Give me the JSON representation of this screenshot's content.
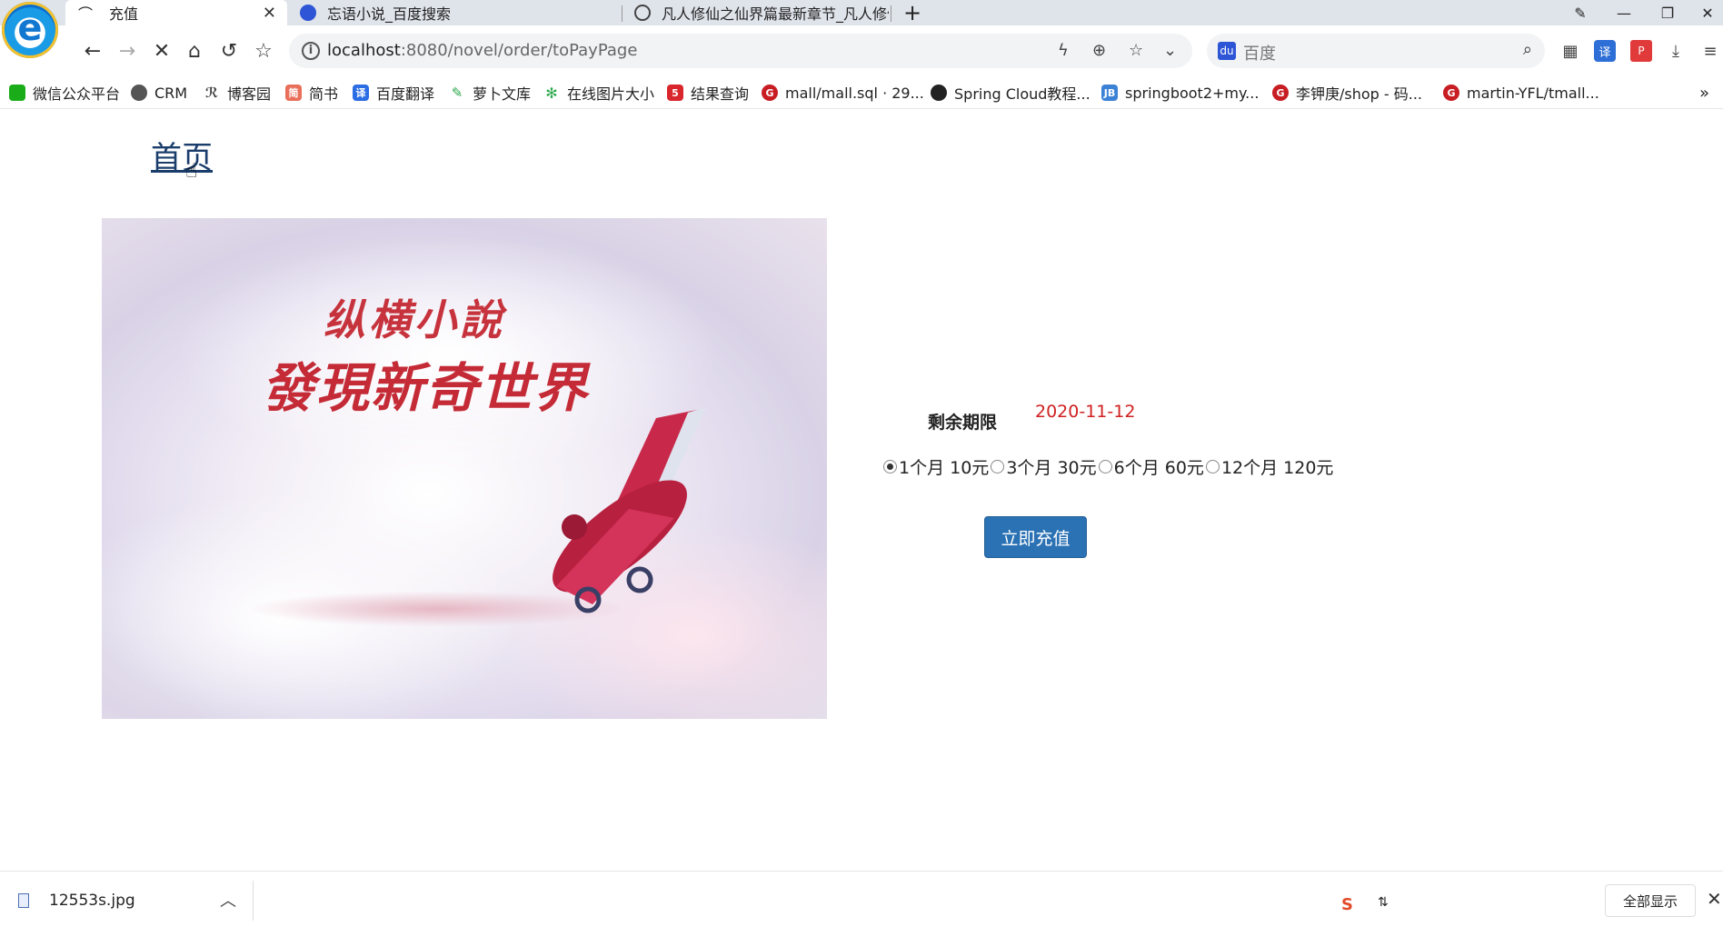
{
  "browser": {
    "tabs": [
      {
        "title": "充值",
        "active": true,
        "close": "✕"
      },
      {
        "title": "忘语小说_百度搜索",
        "active": false
      },
      {
        "title": "凡人修仙之仙界篇最新章节_凡人修仙",
        "active": false
      }
    ],
    "new_tab": "+",
    "address": {
      "host": "localhost",
      "rest": ":8080/novel/order/toPayPage"
    },
    "search_placeholder": "百度",
    "bookmarks": [
      {
        "label": "微信公众平台",
        "color": "#1aad19"
      },
      {
        "label": "CRM",
        "color": "#555555"
      },
      {
        "label": "博客园",
        "color": "#444444"
      },
      {
        "label": "简书",
        "color": "#ea6f5a"
      },
      {
        "label": "百度翻译",
        "color": "#2b6de5"
      },
      {
        "label": "萝卜文库",
        "color": "#e8a21e"
      },
      {
        "label": "在线图片大小",
        "color": "#2aa84a"
      },
      {
        "label": "结果查询",
        "color": "#d9262c"
      },
      {
        "label": "mall/mall.sql · 29...",
        "color": "#c71d23"
      },
      {
        "label": "Spring Cloud教程...",
        "color": "#222222"
      },
      {
        "label": "springboot2+my...",
        "color": "#3b82d6"
      },
      {
        "label": "李钾庚/shop - 码...",
        "color": "#c71d23"
      },
      {
        "label": "martin-YFL/tmall...",
        "color": "#c71d23"
      }
    ],
    "bookmarks_more": "»"
  },
  "page": {
    "home_link": "首页",
    "banner": {
      "line1": "纵横小說",
      "line2": "發現新奇世界"
    },
    "expiry_label": "剩余期限",
    "expiry_value": "2020-11-12",
    "plans": [
      {
        "label": "1个月 10元",
        "checked": true
      },
      {
        "label": "3个月 30元",
        "checked": false
      },
      {
        "label": "6个月 60元",
        "checked": false
      },
      {
        "label": "12个月 120元",
        "checked": false
      }
    ],
    "pay_button": "立即充值"
  },
  "downloads": {
    "file": "12553s.jpg",
    "show_all": "全部显示",
    "close": "✕"
  },
  "ime_label": "S"
}
